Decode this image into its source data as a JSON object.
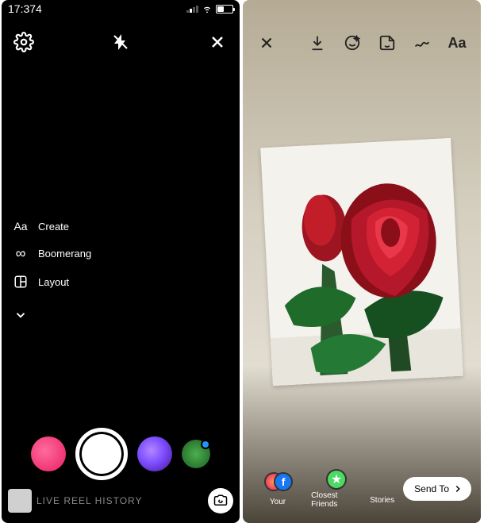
{
  "left": {
    "status": {
      "time": "17:374"
    },
    "modes": {
      "create": {
        "icon": "Aa",
        "label": "Create"
      },
      "boomerang": {
        "icon": "∞",
        "label": "Boomerang"
      },
      "layout": {
        "label": "Layout"
      }
    },
    "bottom": {
      "modes": "LIVE  REEL  HISTORY"
    }
  },
  "right": {
    "tools": {
      "text_icon": "Aa"
    },
    "share": {
      "your_label": "Your",
      "closefriends_label": "Closest Friends",
      "stories_label": "Stories",
      "sendto_label": "Send To"
    }
  }
}
